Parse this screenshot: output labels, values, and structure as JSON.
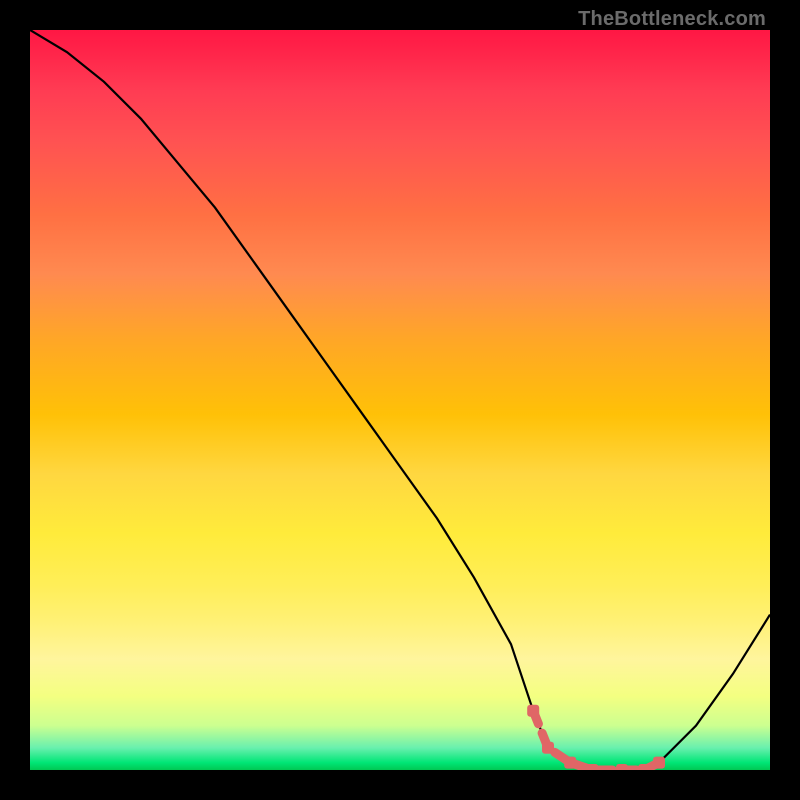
{
  "watermark": "TheBottleneck.com",
  "chart_data": {
    "type": "line",
    "title": "",
    "xlabel": "",
    "ylabel": "",
    "xlim": [
      0,
      100
    ],
    "ylim": [
      0,
      100
    ],
    "series": [
      {
        "name": "bottleneck-curve",
        "x": [
          0,
          5,
          10,
          15,
          20,
          25,
          30,
          35,
          40,
          45,
          50,
          55,
          60,
          65,
          68,
          70,
          73,
          76,
          80,
          83,
          85,
          90,
          95,
          100
        ],
        "values": [
          100,
          97,
          93,
          88,
          82,
          76,
          69,
          62,
          55,
          48,
          41,
          34,
          26,
          17,
          8,
          3,
          1,
          0,
          0,
          0,
          1,
          6,
          13,
          21
        ]
      },
      {
        "name": "marker-band",
        "x": [
          68,
          70,
          73,
          76,
          80,
          83,
          85
        ],
        "values": [
          8,
          3,
          1,
          0,
          0,
          0,
          1
        ]
      }
    ],
    "colors": {
      "curve": "#000000",
      "markers": "#e06666",
      "gradient_top": "#ff1744",
      "gradient_mid": "#ffeb3b",
      "gradient_bottom": "#00c853",
      "background": "#000000"
    }
  }
}
